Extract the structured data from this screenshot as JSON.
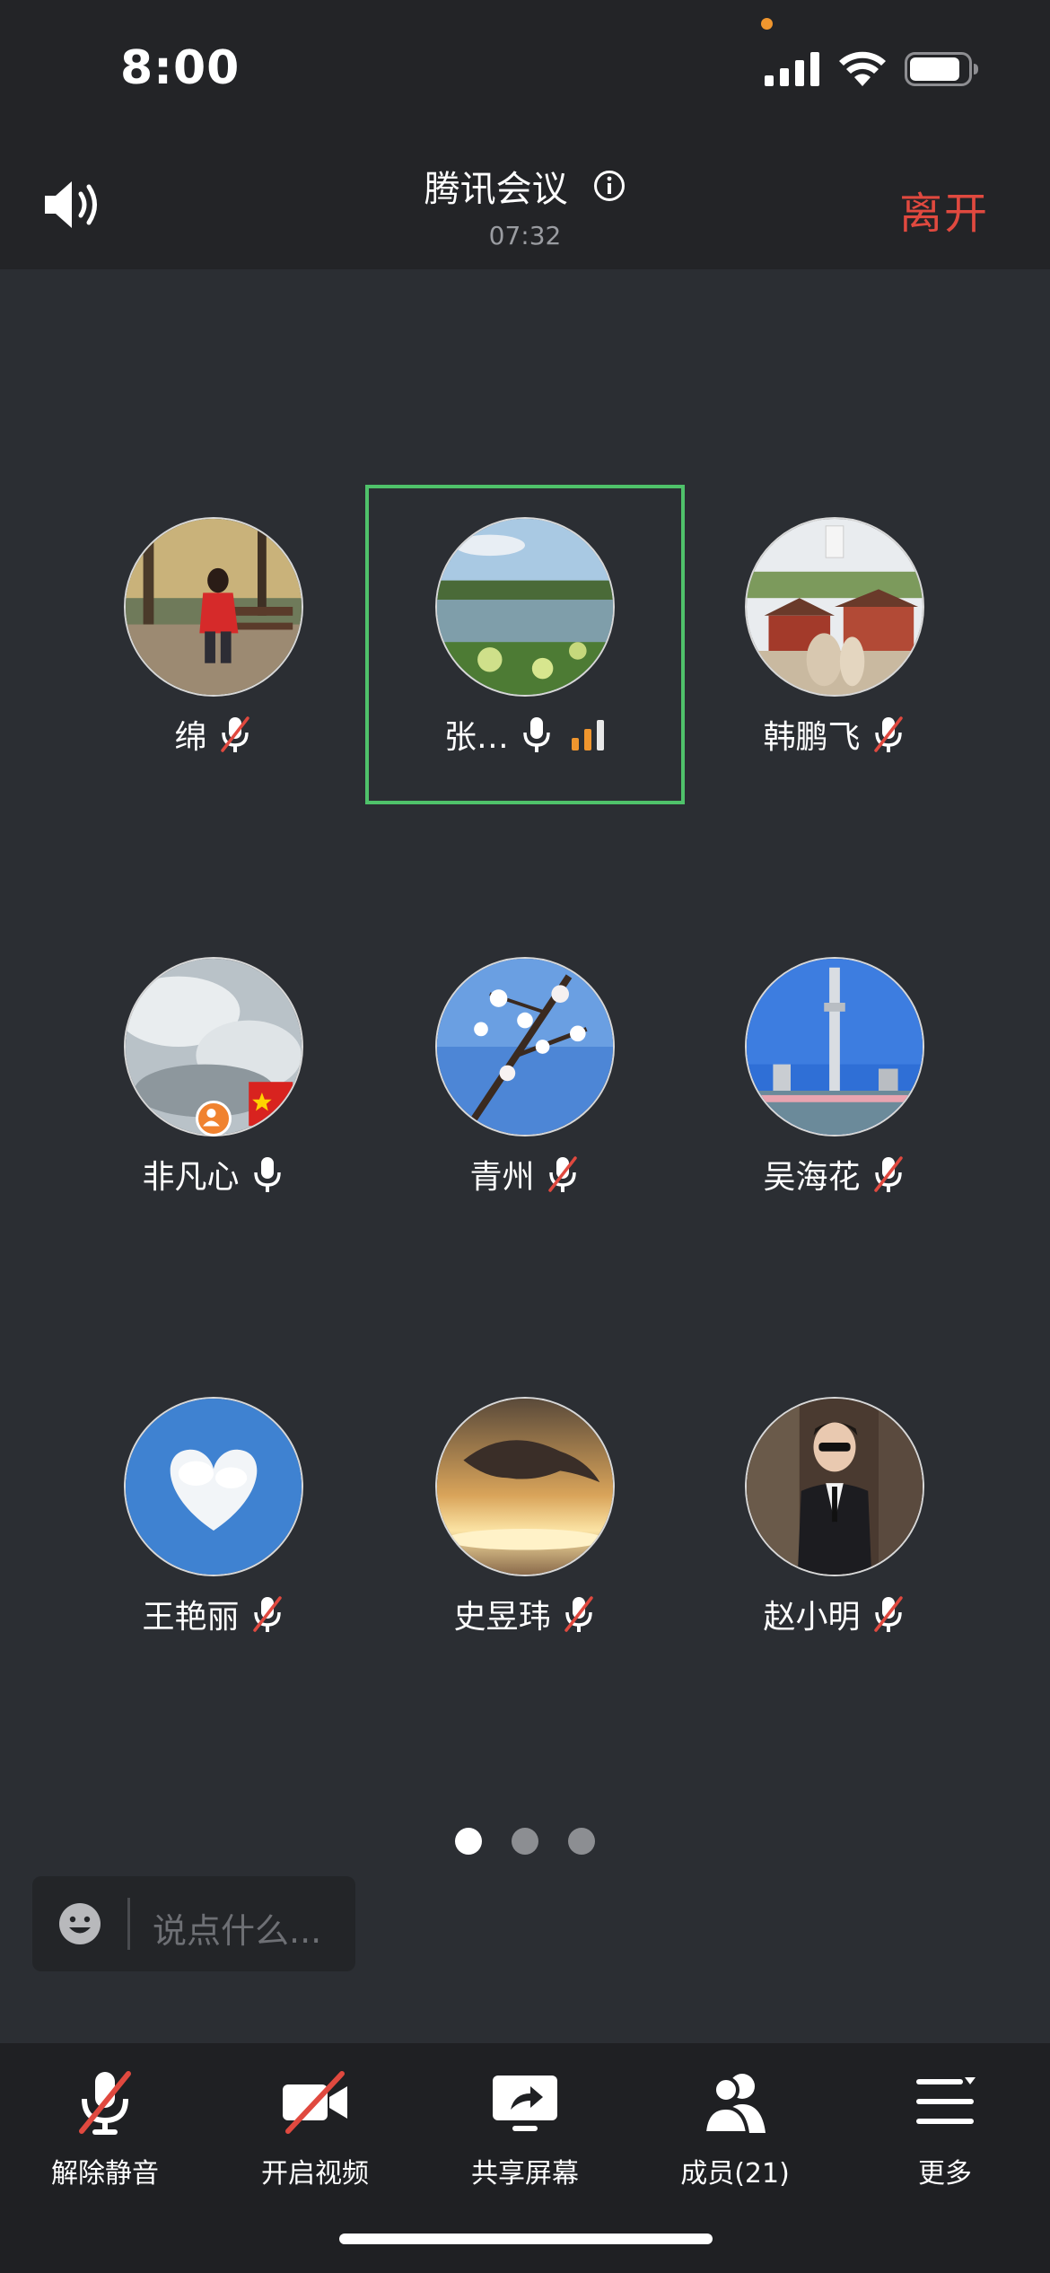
{
  "status_bar": {
    "time": "8:00",
    "icons": [
      "signal-icon",
      "wifi-icon",
      "battery-icon"
    ]
  },
  "header": {
    "title": "腾讯会议",
    "timer": "07:32",
    "leave_label": "离开",
    "speaker_icon": "speaker-icon",
    "info_icon": "info-icon"
  },
  "participants": [
    {
      "name": "绵",
      "mic": "muted",
      "active": false
    },
    {
      "name": "张…",
      "mic": "on",
      "active": true,
      "speaking_level": 2
    },
    {
      "name": "韩鹏飞",
      "mic": "muted",
      "active": false
    },
    {
      "name": "非凡心",
      "mic": "on",
      "active": false,
      "host": true
    },
    {
      "name": "青州",
      "mic": "muted",
      "active": false
    },
    {
      "name": "吴海花",
      "mic": "muted",
      "active": false
    },
    {
      "name": "王艳丽",
      "mic": "muted",
      "active": false
    },
    {
      "name": "史昱玮",
      "mic": "muted",
      "active": false
    },
    {
      "name": "赵小明",
      "mic": "muted",
      "active": false
    }
  ],
  "pager": {
    "pages": 3,
    "current": 1
  },
  "chat": {
    "placeholder": "说点什么..."
  },
  "toolbar": {
    "unmute_label": "解除静音",
    "video_label": "开启视频",
    "share_label": "共享屏幕",
    "members_label": "成员(21)",
    "more_label": "更多"
  },
  "colors": {
    "background": "#2b2e33",
    "bar": "#232427",
    "leave": "#e0493f",
    "active_border": "#4fc26a",
    "level": "#f0962e",
    "mute_slash": "#e0493f"
  }
}
